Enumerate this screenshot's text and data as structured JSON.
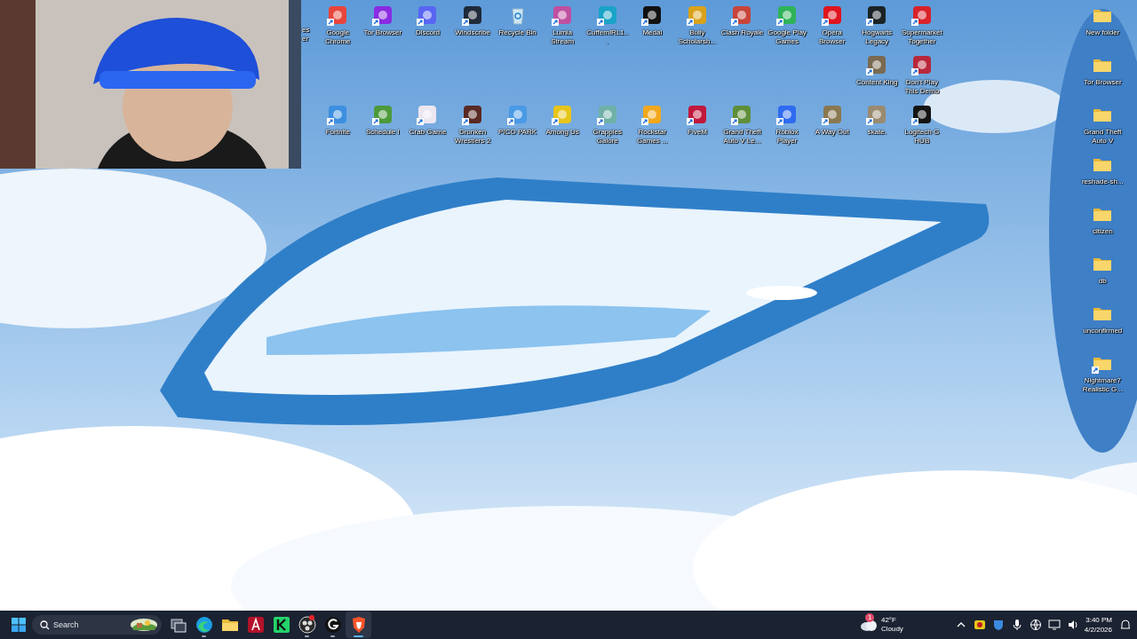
{
  "desktop": {
    "cut_label": "es er",
    "rows": [
      [
        {
          "label": "Google Chrome",
          "kind": "app",
          "color": "#e8453c",
          "shortcut": true
        },
        {
          "label": "Tor Browser",
          "kind": "app",
          "color": "#8a2be2",
          "shortcut": true
        },
        {
          "label": "Discord",
          "kind": "app",
          "color": "#5865f2",
          "shortcut": true
        },
        {
          "label": "Windscribe",
          "kind": "app",
          "color": "#1f2a3a",
          "shortcut": true
        },
        {
          "label": "Recycle Bin",
          "kind": "bin",
          "color": "#cfe6f5",
          "shortcut": false
        },
        {
          "label": "Lumia Stream",
          "kind": "app",
          "color": "#c04fa0",
          "shortcut": true
        },
        {
          "label": "CuffemIRL1...",
          "kind": "app",
          "color": "#1aa3c8",
          "shortcut": true
        },
        {
          "label": "Medal",
          "kind": "app",
          "color": "#111111",
          "shortcut": true
        },
        {
          "label": "Bully Scholarsh...",
          "kind": "app",
          "color": "#d9a21b",
          "shortcut": true
        },
        {
          "label": "Clash Royale",
          "kind": "app",
          "color": "#c8443a",
          "shortcut": true
        },
        {
          "label": "Google Play Games",
          "kind": "app",
          "color": "#2fb35a",
          "shortcut": true
        },
        {
          "label": "Opera Browser",
          "kind": "app",
          "color": "#e0141e",
          "shortcut": true
        },
        {
          "label": "Hogwarts Legacy",
          "kind": "app",
          "color": "#1b2326",
          "shortcut": true
        },
        {
          "label": "Supermarket Together",
          "kind": "app",
          "color": "#d8232a",
          "shortcut": true
        }
      ],
      [
        "",
        "",
        "",
        "",
        "",
        "",
        "",
        "",
        "",
        "",
        "",
        "",
        {
          "label": "Content King",
          "kind": "app",
          "color": "#7a6a50",
          "shortcut": true
        },
        {
          "label": "Don't Play This Demo",
          "kind": "app",
          "color": "#b8283a",
          "shortcut": true
        }
      ],
      [
        {
          "label": "Fortnite",
          "kind": "app",
          "color": "#3d8fe0",
          "shortcut": true
        },
        {
          "label": "Schedule I",
          "kind": "app",
          "color": "#4c9a3a",
          "shortcut": true
        },
        {
          "label": "Crab Game",
          "kind": "app",
          "color": "#ece6f0",
          "shortcut": true
        },
        {
          "label": "Drunken Wrestlers 2",
          "kind": "app",
          "color": "#5a2a24",
          "shortcut": true
        },
        {
          "label": "PICO PARK",
          "kind": "app",
          "color": "#4a9ae6",
          "shortcut": true
        },
        {
          "label": "Among Us",
          "kind": "app",
          "color": "#e8c51a",
          "shortcut": true
        },
        {
          "label": "Grapples Galore",
          "kind": "app",
          "color": "#6fb0a8",
          "shortcut": true
        },
        {
          "label": "Rockstar Games ...",
          "kind": "app",
          "color": "#f2a81c",
          "shortcut": true
        },
        {
          "label": "FiveM",
          "kind": "app",
          "color": "#c0183c",
          "shortcut": true
        },
        {
          "label": "Grand Theft Auto V Le...",
          "kind": "app",
          "color": "#5f8f3a",
          "shortcut": true
        },
        {
          "label": "Roblox Player",
          "kind": "app",
          "color": "#2f6bf0",
          "shortcut": true
        },
        {
          "label": "A Way Out",
          "kind": "app",
          "color": "#8a7850",
          "shortcut": true
        },
        {
          "label": "skate.",
          "kind": "app",
          "color": "#9a8a70",
          "shortcut": true
        },
        {
          "label": "Logitech G HUB",
          "kind": "app",
          "color": "#141414",
          "shortcut": true
        }
      ]
    ],
    "side_column": [
      {
        "label": "New folder",
        "kind": "folder",
        "shortcut": false
      },
      {
        "label": "Tor Browser",
        "kind": "folder",
        "shortcut": false
      },
      {
        "label": "Grand Theft Auto V",
        "kind": "folder",
        "shortcut": false
      },
      {
        "label": "reshade-sh...",
        "kind": "folder",
        "shortcut": false
      },
      {
        "label": "citizen",
        "kind": "folder",
        "shortcut": false
      },
      {
        "label": "db",
        "kind": "folder",
        "shortcut": false
      },
      {
        "label": "unconfirmed",
        "kind": "folder",
        "shortcut": false
      },
      {
        "label": "Nightmare7 Realistic G...",
        "kind": "folder",
        "shortcut": true
      }
    ]
  },
  "taskbar": {
    "search": {
      "placeholder": "Search"
    },
    "apps": [
      {
        "kind": "task-view",
        "running": false,
        "selected": false,
        "notification": false
      },
      {
        "kind": "edge",
        "running": true,
        "selected": false,
        "notification": false
      },
      {
        "kind": "explorer",
        "running": false,
        "selected": false,
        "notification": false
      },
      {
        "kind": "red-app",
        "running": false,
        "selected": false,
        "notification": false
      },
      {
        "kind": "green-app",
        "running": false,
        "selected": false,
        "notification": false
      },
      {
        "kind": "recorder",
        "running": true,
        "selected": false,
        "notification": true
      },
      {
        "kind": "g-app",
        "running": true,
        "selected": false,
        "notification": false
      },
      {
        "kind": "brave",
        "running": true,
        "selected": true,
        "notification": false
      }
    ],
    "weather": {
      "alert": "1",
      "temperature": "42°F",
      "condition": "Cloudy"
    },
    "clock": {
      "time": "3:40 PM",
      "date": "4/2/2026"
    }
  }
}
